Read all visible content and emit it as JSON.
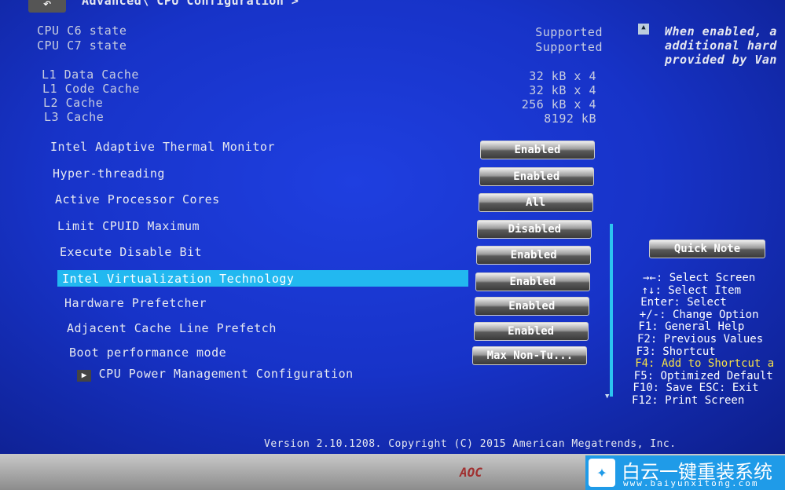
{
  "header": {
    "breadcrumb": "Advanced\\ CPU Configuration >"
  },
  "info": [
    {
      "label": "CPU C6 state",
      "value": "Supported"
    },
    {
      "label": "CPU C7 state",
      "value": "Supported"
    },
    {
      "label": "L1 Data Cache",
      "value": "32 kB x 4"
    },
    {
      "label": "L1 Code Cache",
      "value": "32 kB x 4"
    },
    {
      "label": "L2 Cache",
      "value": "256 kB x 4"
    },
    {
      "label": "L3 Cache",
      "value": "8192 kB"
    }
  ],
  "settings": [
    {
      "label": "Intel Adaptive Thermal Monitor",
      "value": "Enabled"
    },
    {
      "label": "Hyper-threading",
      "value": "Enabled"
    },
    {
      "label": "Active Processor Cores",
      "value": "All"
    },
    {
      "label": "Limit CPUID Maximum",
      "value": "Disabled"
    },
    {
      "label": "Execute Disable Bit",
      "value": "Enabled"
    },
    {
      "label": "Intel Virtualization Technology",
      "value": "Enabled",
      "selected": true
    },
    {
      "label": "Hardware Prefetcher",
      "value": "Enabled"
    },
    {
      "label": "Adjacent Cache Line Prefetch",
      "value": "Enabled"
    },
    {
      "label": "Boot performance mode",
      "value": "Max Non-Tu..."
    }
  ],
  "submenu": "CPU Power Management Configuration",
  "description": [
    "When enabled, a",
    "additional hard",
    "provided by Van"
  ],
  "quick_note": "Quick Note",
  "help": [
    "→←: Select Screen",
    "↑↓: Select Item",
    "Enter: Select",
    "+/-: Change Option",
    "F1: General Help",
    "F2: Previous Values",
    "F3: Shortcut",
    "F4: Add to Shortcut a",
    "F5: Optimized Default",
    "F10: Save  ESC: Exit",
    "F12: Print Screen"
  ],
  "footer": "Version 2.10.1208. Copyright (C) 2015 American Megatrends, Inc.",
  "monitor_brand": "AOC",
  "watermark": {
    "title": "白云一键重装系统",
    "url": "www.baiyunxitong.com"
  },
  "colors": {
    "highlight": "#22b8f0",
    "shortcut_key": "#f5e04a",
    "background": "#1733c8"
  }
}
